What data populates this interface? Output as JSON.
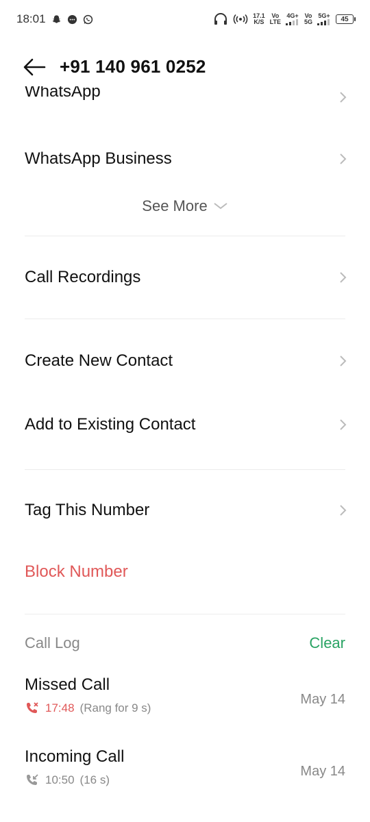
{
  "status_bar": {
    "time": "18:01",
    "net_speed_value": "17.1",
    "net_speed_unit": "K/S",
    "sim1_top": "Vo",
    "sim1_bottom": "LTE",
    "sim1_net": "4G+",
    "sim2_top": "Vo",
    "sim2_bottom": "5G",
    "sim2_net": "5G+",
    "battery": "45",
    "icons": [
      "snapchat-icon",
      "message-bubble-icon",
      "whatsapp-icon",
      "headphones-icon",
      "hotspot-icon",
      "signal-icon",
      "battery-icon"
    ]
  },
  "header": {
    "title": "+91 140 961 0252",
    "back_icon": "back-arrow-icon"
  },
  "apps": [
    {
      "label": "WhatsApp"
    },
    {
      "label": "WhatsApp Business"
    }
  ],
  "see_more": "See More",
  "actions": {
    "call_recordings": "Call Recordings",
    "create_new_contact": "Create New Contact",
    "add_to_existing": "Add to Existing Contact",
    "tag_number": "Tag This Number",
    "block_number": "Block Number"
  },
  "call_log": {
    "title": "Call Log",
    "clear": "Clear",
    "entries": [
      {
        "type": "Missed Call",
        "time": "17:48",
        "detail": "(Rang for 9 s)",
        "date": "May 14"
      },
      {
        "type": "Incoming Call",
        "time": "10:50",
        "detail": "(16 s)",
        "date": "May 14"
      }
    ]
  },
  "colors": {
    "danger": "#e05858",
    "accent_green": "#29a363",
    "text_secondary": "#888888"
  }
}
